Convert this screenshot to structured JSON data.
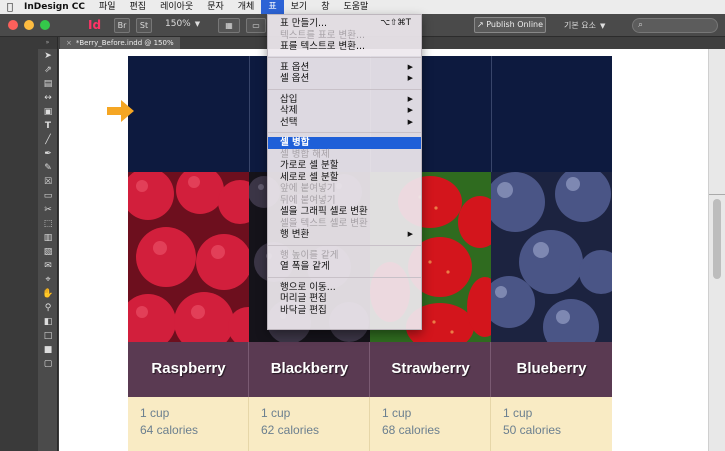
{
  "menubar": {
    "app_name": "InDesign CC",
    "items": [
      "파일",
      "편집",
      "레이아웃",
      "문자",
      "개체",
      "표",
      "보기",
      "창",
      "도움말"
    ],
    "active_index": 5
  },
  "appbar": {
    "logo": "Id",
    "btn_br": "Br",
    "btn_st": "St",
    "zoom": "150%",
    "publish_label": "Publish Online",
    "workspace": "기본 요소"
  },
  "document_tab": "*Berry_Before.indd @ 150%",
  "menu": {
    "groups": [
      [
        {
          "label": "표 만들기...",
          "shortcut": "⌥⇧⌘T",
          "disabled": false
        },
        {
          "label": "텍스트를 표로 변환...",
          "disabled": true
        },
        {
          "label": "표를 텍스트로 변환...",
          "disabled": false
        }
      ],
      [
        {
          "label": "표 옵션",
          "submenu": true,
          "disabled": false
        },
        {
          "label": "셀 옵션",
          "submenu": true,
          "disabled": false
        }
      ],
      [
        {
          "label": "삽입",
          "submenu": true,
          "disabled": false
        },
        {
          "label": "삭제",
          "submenu": true,
          "disabled": false
        },
        {
          "label": "선택",
          "submenu": true,
          "disabled": false
        }
      ],
      [
        {
          "label": "셀 병합",
          "highlighted": true,
          "disabled": false
        },
        {
          "label": "셀 병합 해제",
          "disabled": true
        },
        {
          "label": "가로로 셀 분할",
          "disabled": false
        },
        {
          "label": "세로로 셀 분할",
          "disabled": false
        },
        {
          "label": "앞에 붙여넣기",
          "disabled": true
        },
        {
          "label": "뒤에 붙여넣기",
          "disabled": true
        },
        {
          "label": "셀을 그래픽 셀로 변환",
          "disabled": false
        },
        {
          "label": "셀을 텍스트 셀로 변환",
          "disabled": true
        },
        {
          "label": "행 변환",
          "submenu": true,
          "disabled": false
        }
      ],
      [
        {
          "label": "행 높이를 같게",
          "disabled": true
        },
        {
          "label": "열 폭을 같게",
          "disabled": false
        }
      ],
      [
        {
          "label": "행으로 이동...",
          "disabled": false
        },
        {
          "label": "머리글 편집",
          "disabled": false
        },
        {
          "label": "바닥글 편집",
          "disabled": false
        }
      ]
    ]
  },
  "table": {
    "berries": [
      {
        "name": "Raspberry",
        "amount": "1 cup",
        "calories": "64 calories"
      },
      {
        "name": "Blackberry",
        "amount": "1 cup",
        "calories": "62 calories"
      },
      {
        "name": "Strawberry",
        "amount": "1 cup",
        "calories": "68 calories"
      },
      {
        "name": "Blueberry",
        "amount": "1 cup",
        "calories": "50 calories"
      }
    ]
  },
  "colors": {
    "header_navy": "#0d1a3f",
    "name_row": "#5a3a52",
    "info_row": "#f9ebc4",
    "menu_highlight": "#1e5fd8",
    "arrow": "#f5a623"
  }
}
